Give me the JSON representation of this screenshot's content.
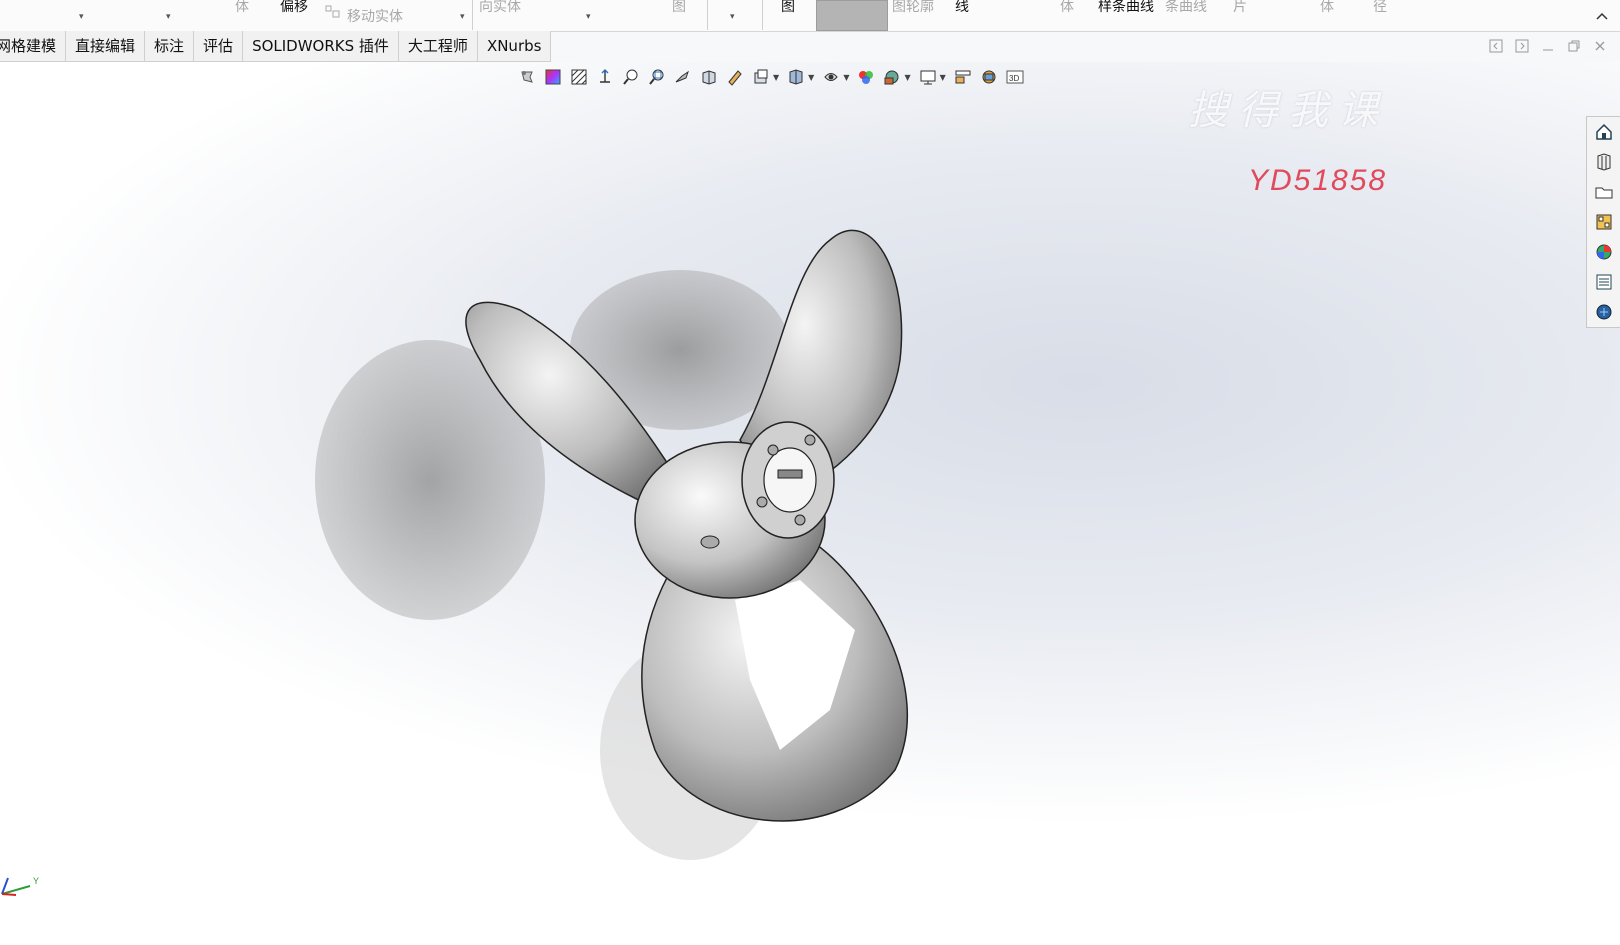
{
  "ribbon": {
    "labels": [
      {
        "text": "体",
        "state": "dim"
      },
      {
        "text": "偏移",
        "state": "on"
      },
      {
        "text": "移动实体",
        "state": "dim"
      },
      {
        "text": "向实体",
        "state": "dim"
      },
      {
        "text": "图",
        "state": "dim"
      },
      {
        "text": "图",
        "state": "on"
      },
      {
        "text": "图轮廓",
        "state": "dim"
      },
      {
        "text": "线",
        "state": "on"
      },
      {
        "text": "体",
        "state": "dim"
      },
      {
        "text": "样条曲线",
        "state": "on"
      },
      {
        "text": "条曲线",
        "state": "dim"
      },
      {
        "text": "片",
        "state": "dim"
      },
      {
        "text": "体",
        "state": "dim"
      },
      {
        "text": "径",
        "state": "dim"
      }
    ]
  },
  "tabs": [
    "网格建模",
    "直接编辑",
    "标注",
    "评估",
    "SOLIDWORKS 插件",
    "大工程师",
    "XNurbs"
  ],
  "heads_up_icons": [
    "view-orientation-icon",
    "appearance-icon",
    "section-view-icon",
    "standard-views-icon",
    "zoom-to-fit-icon",
    "zoom-to-area-icon",
    "previous-view-icon",
    "display-style-icon",
    "hide-show-icon",
    "view-settings-icon",
    "edit-appearance-icon",
    "scene-icon",
    "monitor-icon",
    "render-icon",
    "realview-icon",
    "3d-view-icon"
  ],
  "watermark": {
    "chinese": "搜得我课",
    "code": "YD51858"
  },
  "taskpane_icons": [
    "home-icon",
    "part-library-icon",
    "file-explorer-icon",
    "view-palette-icon",
    "appearances-icon",
    "custom-properties-icon",
    "solidworks-forum-icon"
  ],
  "triad": {
    "y_label": "Y"
  },
  "colors": {
    "watermark_code": "#e04a5c",
    "ribbon_active_block": "#b4b4b4"
  }
}
